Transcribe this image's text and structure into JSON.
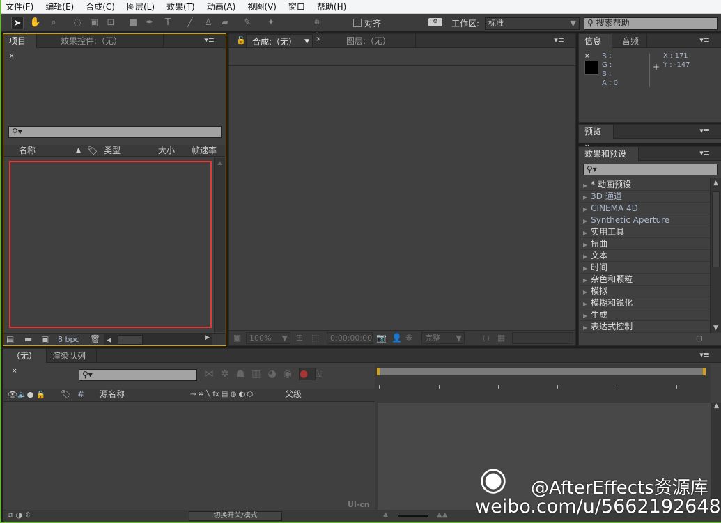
{
  "menu": [
    "文件(F)",
    "编辑(E)",
    "合成(C)",
    "图层(L)",
    "效果(T)",
    "动画(A)",
    "视图(V)",
    "窗口",
    "帮助(H)"
  ],
  "toolbar": {
    "snap_label": "对齐",
    "workspace_label": "工作区:",
    "workspace_value": "标准",
    "help_search": "搜索帮助"
  },
  "project": {
    "tabs": [
      "项目",
      "效果控件:（无）"
    ],
    "columns": [
      "名称",
      "类型",
      "大小",
      "帧速率"
    ],
    "bpc": "8 bpc"
  },
  "comp": {
    "tabs": [
      "合成:（无）",
      "图层:（无）"
    ],
    "zoom": "100%",
    "timecode": "0:00:00:00",
    "resolution": "完整"
  },
  "info": {
    "tabs": [
      "信息",
      "音频"
    ],
    "r": "R :",
    "g": "G :",
    "b": "B :",
    "a": "A : 0",
    "x": "X : 171",
    "y": "Y : -147"
  },
  "preview": {
    "tab": "预览"
  },
  "effects": {
    "tab": "效果和预设",
    "items": [
      {
        "label": "* 动画预设",
        "blue": false
      },
      {
        "label": "3D 通道",
        "blue": true
      },
      {
        "label": "CINEMA 4D",
        "blue": true
      },
      {
        "label": "Synthetic Aperture",
        "blue": true
      },
      {
        "label": "实用工具",
        "blue": false
      },
      {
        "label": "扭曲",
        "blue": false
      },
      {
        "label": "文本",
        "blue": false
      },
      {
        "label": "时间",
        "blue": false
      },
      {
        "label": "杂色和颗粒",
        "blue": false
      },
      {
        "label": "模拟",
        "blue": false
      },
      {
        "label": "模糊和锐化",
        "blue": false
      },
      {
        "label": "生成",
        "blue": false
      },
      {
        "label": "表达式控制",
        "blue": false
      }
    ]
  },
  "timeline": {
    "tabs": [
      "（无）",
      "渲染队列"
    ],
    "columns": {
      "num": "#",
      "source": "源名称",
      "parent": "父级"
    },
    "toggle_label": "切换开关/模式"
  },
  "watermark": {
    "line1": "@AfterEffects资源库",
    "line2": "weibo.com/u/5662192648",
    "logo": "UI·cn"
  },
  "colors": {
    "selection_border": "#e03a3a",
    "active_panel": "#d7a100",
    "work_area": "#d4a017"
  }
}
